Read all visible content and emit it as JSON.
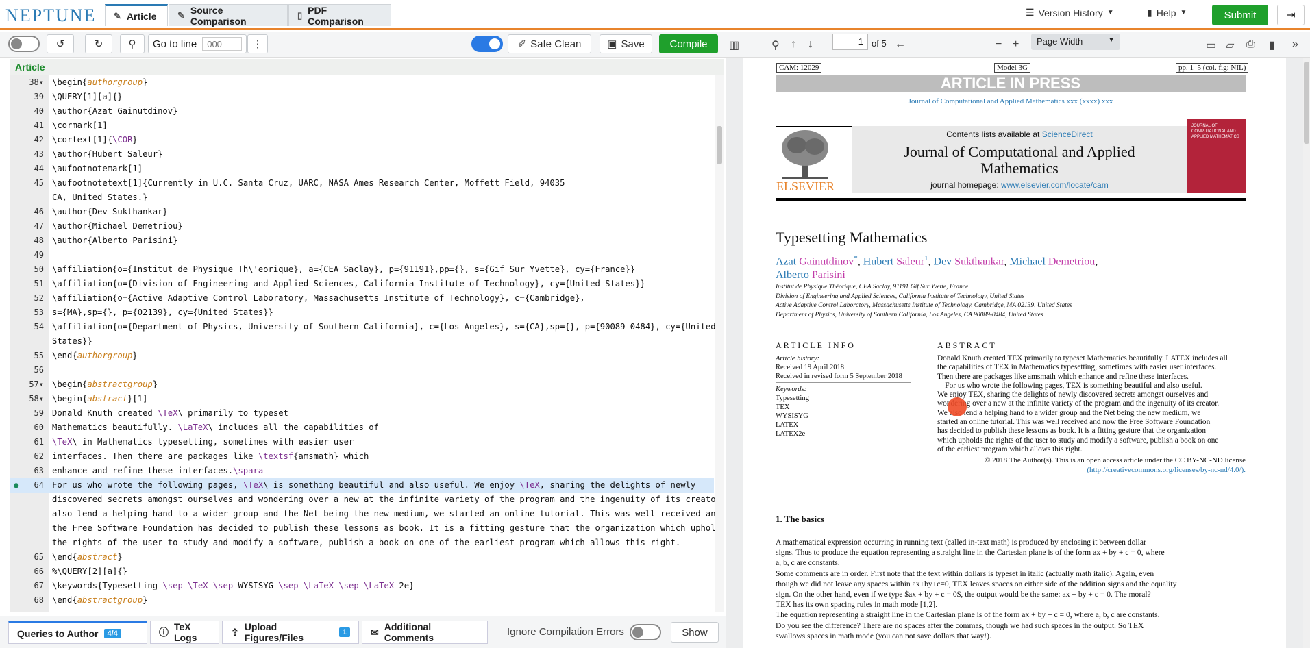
{
  "header": {
    "logo": "NEPTUNE",
    "tabs": [
      {
        "label": "Article",
        "icon": "pencil-icon"
      },
      {
        "label": "Source Comparison",
        "icon": "pencil-icon"
      },
      {
        "label": "PDF Comparison",
        "icon": "document-icon"
      }
    ],
    "version_history": "Version History",
    "help": "Help",
    "submit": "Submit"
  },
  "toolbar": {
    "goto_label": "Go to line",
    "goto_placeholder": "000",
    "safe_clean": "Safe Clean",
    "save": "Save",
    "compile": "Compile"
  },
  "editor": {
    "title": "Article",
    "lines": [
      {
        "num": "38",
        "fold": true,
        "html": "\\begin{<i class=arg>authorgroup</i>}"
      },
      {
        "num": "39",
        "html": "\\QUERY[1][a]{}"
      },
      {
        "num": "40",
        "html": "\\author{Azat Gainutdinov}"
      },
      {
        "num": "41",
        "html": "\\cormark[1]"
      },
      {
        "num": "42",
        "html": "\\cortext[1]{<span class=kw>\\COR</span>}"
      },
      {
        "num": "43",
        "html": "\\author{Hubert Saleur}"
      },
      {
        "num": "44",
        "html": "\\aufootnotemark[1]"
      },
      {
        "num": "45",
        "html": "\\aufootnotetext[1]{Currently in U.C. Santa Cruz, UARC, NASA Ames Research Center, Moffett Field, 94035"
      },
      {
        "num": "",
        "html": "CA, United States.}"
      },
      {
        "num": "46",
        "html": "\\author{Dev Sukthankar}"
      },
      {
        "num": "47",
        "html": "\\author{Michael Demetriou}"
      },
      {
        "num": "48",
        "html": "\\author{Alberto Parisini}"
      },
      {
        "num": "49",
        "html": ""
      },
      {
        "num": "50",
        "html": "\\affiliation{o={Institut de Physique Th\\'eorique}, a={CEA Saclay}, p={91191},pp={}, s={Gif Sur Yvette}, cy={France}}"
      },
      {
        "num": "51",
        "html": "\\affiliation{o={Division of Engineering and Applied Sciences, California Institute of Technology}, cy={United States}}"
      },
      {
        "num": "52",
        "html": "\\affiliation{o={Active Adaptive Control Laboratory, Massachusetts Institute of Technology}, c={Cambridge},"
      },
      {
        "num": "53",
        "html": "s={MA},sp={}, p={02139}, cy={United States}}"
      },
      {
        "num": "54",
        "html": "\\affiliation{o={Department of Physics, University of Southern California}, c={Los Angeles}, s={CA},sp={}, p={90089-0484}, cy={United"
      },
      {
        "num": "",
        "html": "States}}"
      },
      {
        "num": "55",
        "html": "\\end{<i class=arg>authorgroup</i>}"
      },
      {
        "num": "56",
        "html": ""
      },
      {
        "num": "57",
        "fold": true,
        "html": "\\begin{<i class=arg>abstractgroup</i>}"
      },
      {
        "num": "58",
        "fold": true,
        "html": "\\begin{<i class=arg>abstract</i>}[1]"
      },
      {
        "num": "59",
        "html": "Donald Knuth created <span class=kw>\\TeX</span>\\ primarily to typeset"
      },
      {
        "num": "60",
        "html": "Mathematics beautifully. <span class=kw>\\LaTeX</span>\\ includes all the capabilities of"
      },
      {
        "num": "61",
        "html": "<span class=kw>\\TeX</span>\\ in Mathematics typesetting, sometimes with easier user"
      },
      {
        "num": "62",
        "html": "interfaces. Then there are packages like <span class=kw>\\textsf</span>{amsmath} which"
      },
      {
        "num": "63",
        "html": "enhance and refine these interfaces.<span class=kw>\\spara</span>"
      },
      {
        "num": "64",
        "hl": true,
        "comment": true,
        "html": "For us who wrote the following pages, <span class=kw>\\TeX</span>\\ is something beautiful and also useful. We enjoy <span class=kw>\\TeX</span>, sharing the delights of newly"
      },
      {
        "num": "",
        "hl": false,
        "html": "discovered secrets amongst ourselves and wondering over a new at the infinite variety of the program and the ingenuity of its creator. We"
      },
      {
        "num": "",
        "html": "also lend a helping hand to a wider group and the Net being the new medium, we started an online tutorial. This was well received and now"
      },
      {
        "num": "",
        "html": "the Free Software Foundation has decided to publish these lessons as book. It is a fitting gesture that the organization which upholds"
      },
      {
        "num": "",
        "html": "the rights of the user to study and modify a software, publish a book on one of the earliest program which allows this right."
      },
      {
        "num": "65",
        "html": "\\end{<i class=arg>abstract</i>}"
      },
      {
        "num": "66",
        "html": "%\\QUERY[2][a]{}"
      },
      {
        "num": "67",
        "html": "\\keywords{Typesetting <span class=kw>\\sep</span> <span class=kw>\\TeX</span> <span class=kw>\\sep</span> WYSISYG <span class=kw>\\sep</span> <span class=kw>\\LaTeX</span> <span class=kw>\\sep</span> <span class=kw>\\LaTeX</span> 2e}"
      },
      {
        "num": "68",
        "html": "\\end{<i class=arg>abstractgroup</i>}"
      }
    ]
  },
  "bottom": {
    "tabs": [
      {
        "label": "Queries to Author",
        "badge": "4/4"
      },
      {
        "label": "TeX Logs"
      },
      {
        "label": "Upload Figures/Files",
        "badge": "1"
      },
      {
        "label": "Additional Comments"
      }
    ],
    "ignore_errors": "Ignore Compilation Errors",
    "show": "Show"
  },
  "pdf_toolbar": {
    "page": "1",
    "of_pages": "of 5",
    "zoom": "Page Width"
  },
  "pdf": {
    "cam": "CAM: 12029",
    "model": "Model 3G",
    "pp": "pp. 1–5 (col. fig: NIL)",
    "aip": "ARTICLE IN PRESS",
    "journal_ref": "Journal of Computational and Applied Mathematics xxx (xxxx) xxx",
    "contents_pre": "Contents lists available at ",
    "sciencedirect": "ScienceDirect",
    "journal_title": "Journal of Computational and Applied Mathematics",
    "homepage_pre": "journal homepage: ",
    "homepage": "www.elsevier.com/locate/cam",
    "elsevier": "ELSEVIER",
    "cover_text": "JOURNAL OF COMPUTATIONAL AND APPLIED MATHEMATICS",
    "title": "Typesetting Mathematics",
    "affil": [
      "Institut de Physique Théorique, CEA Saclay, 91191 Gif Sur Yvette, France",
      "Division of Engineering and Applied Sciences, California Institute of Technology, United States",
      "Active Adaptive Control Laboratory, Massachusetts Institute of Technology, Cambridge, MA 02139, United States",
      "Department of Physics, University of Southern California, Los Angeles, CA 90089-0484, United States"
    ],
    "article_info": "ARTICLE INFO",
    "abstract_head": "ABSTRACT",
    "history_label": "Article history:",
    "received": "Received 19 April 2018",
    "revised": "Received in revised form 5 September 2018",
    "keywords_label": "Keywords:",
    "keywords": [
      "Typesetting",
      "TEX",
      "WYSISYG",
      "LATEX",
      "LATEX2e"
    ],
    "abstract_lines": [
      "Donald Knuth created TEX primarily to typeset Mathematics beautifully. LATEX includes all",
      "the capabilities of TEX in Mathematics typesetting, sometimes with easier user interfaces.",
      "Then there are packages like amsmath which enhance and refine these interfaces.",
      "    For us who wrote the following pages, TEX is something beautiful and also useful.",
      "We enjoy TEX, sharing the delights of newly discovered secrets amongst ourselves and",
      "wondering over a new at the infinite variety of the program and the ingenuity of its creator.",
      "We also lend a helping hand to a wider group and the Net being the new medium, we",
      "started an online tutorial. This was well received and now the Free Software Foundation",
      "has decided to publish these lessons as book. It is a fitting gesture that the organization",
      "which upholds the rights of the user to study and modify a software, publish a book on one",
      "of the earliest program which allows this right."
    ],
    "copyright": "© 2018 The Author(s). This is an open access article under the CC BY-NC-ND license",
    "license_url": "(http://creativecommons.org/licenses/by-nc-nd/4.0/).",
    "section1": "1.  The basics",
    "body_lines": [
      "A mathematical expression occurring in running text (called in-text math) is produced by enclosing it between dollar",
      "signs. Thus to produce the equation representing a straight line in the Cartesian plane is of the form ax + by + c = 0, where",
      "a, b, c are constants.",
      "Some comments are in order. First note that the text within dollars is typeset in italic (actually math italic). Again, even",
      "though we did not leave any spaces within ax+by+c=0, TEX leaves spaces on either side of the addition signs and the equality",
      "sign. On the other hand, even if we type $ax + by + c = 0$, the output would be the same: ax + by + c = 0. The moral?",
      "TEX has its own spacing rules in math mode [1,2].",
      "The equation representing a straight line in the Cartesian plane is of the form ax + by + c = 0, where a, b, c are constants.",
      "Do you see the difference? There are no spaces after the commas, though we had such spaces in the output. So TEX",
      "swallows spaces in math mode (you can not save dollars that way!)."
    ]
  },
  "colors": {
    "accent_orange": "#e8842c",
    "brand_blue": "#2a7ab4",
    "compile_green": "#1fa02c",
    "highlight": "#d6e8fa"
  }
}
